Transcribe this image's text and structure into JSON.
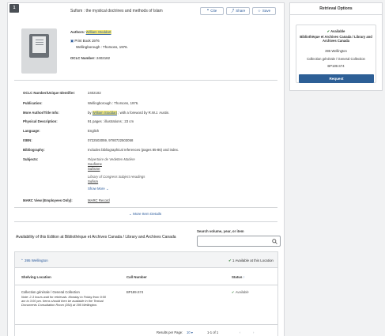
{
  "record": {
    "index": "1",
    "title": "Sufism : the mystical doctrines and methods of Islam",
    "actions": {
      "cite": "Cite",
      "share": "Share",
      "save": "Save"
    },
    "authors_label": "Authors:",
    "author": "William Stoddart",
    "format": "Print Book 1976",
    "publisher_line": "Wellingborough : Thorsons, 1976.",
    "oclc_label": "OCLC Number:",
    "oclc": "2402182"
  },
  "details": [
    {
      "label": "OCLC Number/Unique Identifier:",
      "value": "2402182"
    },
    {
      "label": "Publication:",
      "value": "Wellingborough : Thorsons, 1976."
    },
    {
      "label": "More Author/Title Info:",
      "value_pre": "by ",
      "value_link": "William Stoddart",
      "value_post": " ; with a foreword by R.W.J. Austin."
    },
    {
      "label": "Physical Description:",
      "value": "91 pages : illustrations ; 23 cm"
    },
    {
      "label": "Language:",
      "value": "English"
    },
    {
      "label": "ISBN:",
      "value": "0722503059, 9780722503058"
    },
    {
      "label": "Bibliography:",
      "value": "Includes bibliographical references (pages 85-86) and index."
    },
    {
      "label": "Subjects:",
      "value": ""
    },
    {
      "label": "MARC View (Employees Only):",
      "value": "MARC Record"
    }
  ],
  "subjects": {
    "heading1": "Répertoire de Vedettes-Matière",
    "link1": "Soufisme",
    "link2": "Sufisme",
    "heading2": "Library of Congress Subject Headings",
    "link3": "Sufism",
    "show_more": "Show More"
  },
  "more_details": "More Item Details",
  "availability": {
    "title": "Availability of this Edition at Bibliothèque et Archives Canada / Library and Archives Canada",
    "search_label": "Search volume, year, or item",
    "search_placeholder": "",
    "location_name": "395 Wellington",
    "location_status": "1 Available at this Location",
    "columns": [
      "Shelving Location",
      "Call Number",
      "Status"
    ],
    "row": {
      "shelving": "Collection générale / General Collection",
      "note": "Note: 2-3 hours wait for retrievals. Monday to Friday from 9:00 am to 3:00 pm. Items should then be available in the Textual Documents Consultation Room (354) at 395 Wellington.",
      "call_number": "BP189.S74",
      "status": "Available"
    },
    "footer": {
      "rpp_label": "Results per Page:",
      "rpp_value": "10",
      "range": "1-1 of 1"
    }
  },
  "sidebar": {
    "title": "Retrieval Options",
    "status": "Available",
    "library": "Bibliothèque et Archives Canada / Library and Archives Canada",
    "address": "395 Wellington",
    "collection": "Collection générale / General Collection",
    "call_number": "BP189.S74",
    "request_label": "Request"
  },
  "colors": {
    "accent": "#2d5f96",
    "link": "#2a5a9b",
    "available": "#2e7d32"
  }
}
